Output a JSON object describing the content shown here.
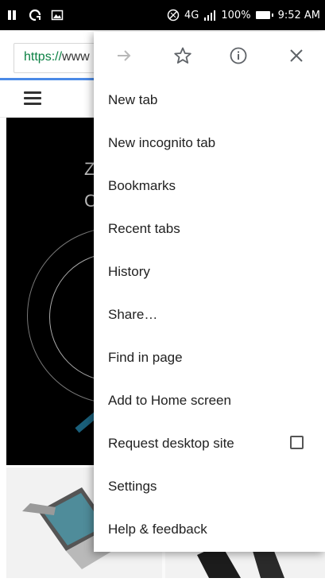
{
  "status_bar": {
    "network": "4G",
    "battery": "100%",
    "time": "9:52 AM"
  },
  "omnibox": {
    "url_scheme": "https://",
    "url_rest": "www"
  },
  "hero": {
    "letter_1": "Z",
    "letter_2": "C"
  },
  "menu": {
    "top_icons": [
      "forward-arrow-icon",
      "bookmark-star-icon",
      "info-icon",
      "close-icon"
    ],
    "items": [
      {
        "label": "New tab"
      },
      {
        "label": "New incognito tab"
      },
      {
        "label": "Bookmarks"
      },
      {
        "label": "Recent tabs"
      },
      {
        "label": "History"
      },
      {
        "label": "Share…"
      },
      {
        "label": "Find in page"
      },
      {
        "label": "Add to Home screen"
      },
      {
        "label": "Request desktop site",
        "checked": false
      },
      {
        "label": "Settings"
      },
      {
        "label": "Help & feedback"
      }
    ]
  },
  "colors": {
    "url_scheme": "#0b8043",
    "progress_bar": "#4b8ae6",
    "menu_text": "#212121",
    "icon_gray": "#5f6368"
  }
}
